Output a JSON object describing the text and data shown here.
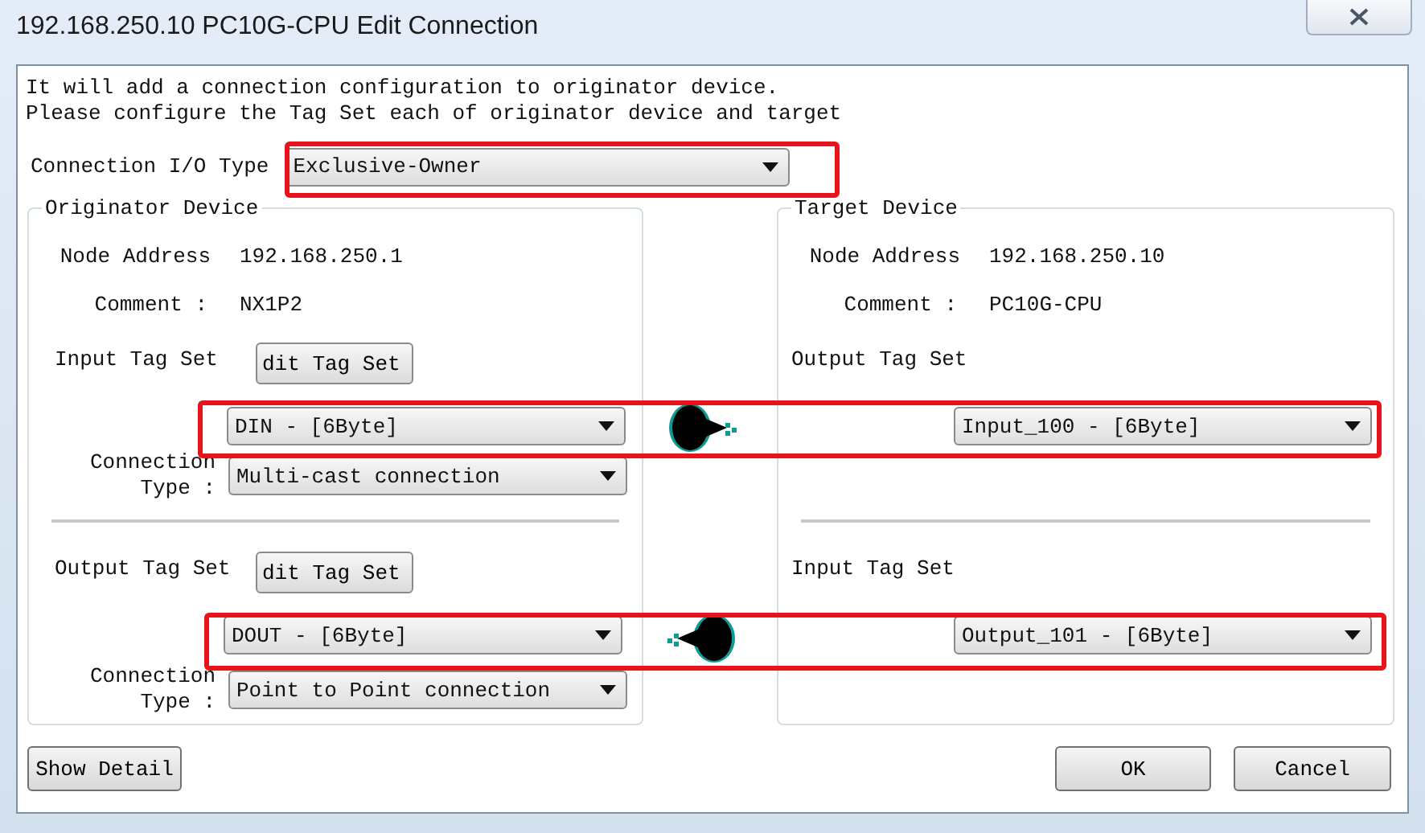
{
  "window": {
    "title": "192.168.250.10 PC10G-CPU Edit Connection"
  },
  "description": [
    "It will add a connection configuration to originator device.",
    "Please configure the Tag Set each of originator device and target"
  ],
  "io_type": {
    "label": "Connection I/O Type",
    "value": "Exclusive-Owner"
  },
  "originator": {
    "title": "Originator Device",
    "node_label": "Node Address",
    "node_address": "192.168.250.1",
    "comment_label": "Comment :",
    "comment": "NX1P2",
    "tag_sets": [
      {
        "label": "Input Tag Set",
        "button": "dit Tag Set",
        "value": "DIN - [6Byte]",
        "connection_label": "Connection Type :",
        "connection": "Multi-cast connection"
      },
      {
        "label": "Output Tag Set",
        "button": "dit Tag Set",
        "value": "DOUT - [6Byte]",
        "connection_label": "Connection Type :",
        "connection": "Point to Point connection"
      }
    ]
  },
  "arrows": [
    {
      "kind": "right"
    },
    {
      "kind": "left"
    }
  ],
  "target": {
    "title": "Target Device",
    "node_label": "Node Address",
    "node_address": "192.168.250.10",
    "comment_label": "Comment :",
    "comment": "PC10G-CPU",
    "tag_sets": [
      {
        "label": "Output Tag Set",
        "value": "Input_100 - [6Byte]"
      },
      {
        "label": "Input Tag Set",
        "value": "Output_101 - [6Byte]"
      }
    ]
  },
  "buttons": {
    "detail": "Show Detail",
    "ok": "OK",
    "cancel": "Cancel"
  }
}
